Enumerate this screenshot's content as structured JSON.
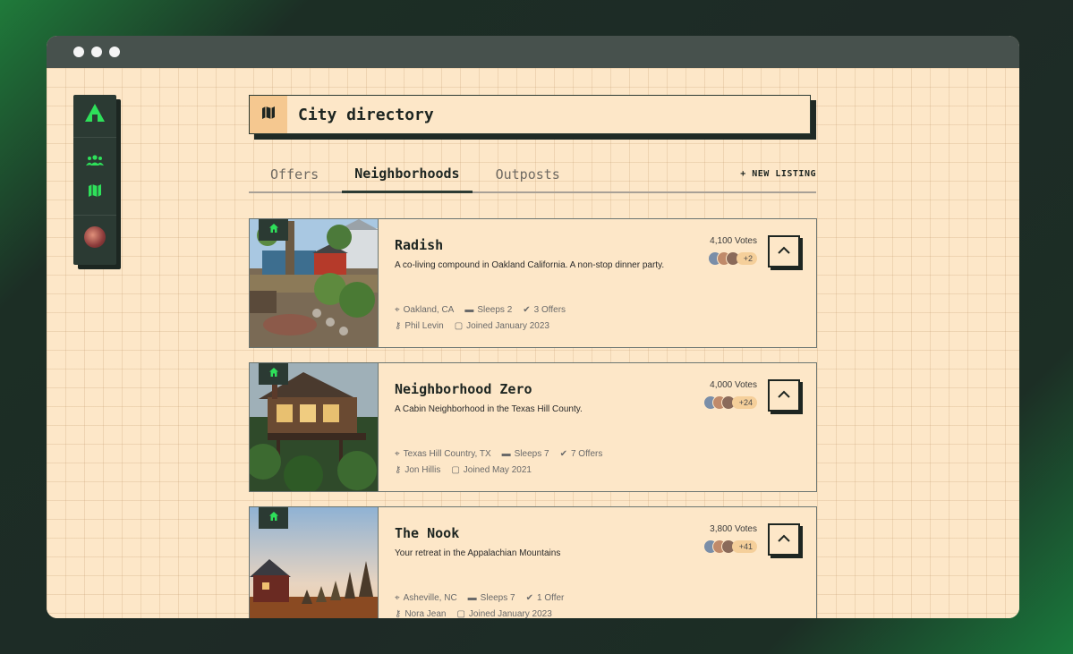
{
  "window": {
    "buttons": [
      "close",
      "minimize",
      "maximize"
    ]
  },
  "sidebar": {
    "logo_icon": "home-triangle-icon",
    "items": [
      {
        "icon": "people-icon"
      },
      {
        "icon": "map-icon"
      }
    ],
    "avatar": "user-avatar"
  },
  "search": {
    "icon": "map-icon",
    "title": "City directory"
  },
  "tabs": {
    "items": [
      {
        "label": "Offers"
      },
      {
        "label": "Neighborhoods"
      },
      {
        "label": "Outposts"
      }
    ],
    "active": "Neighborhoods",
    "new_listing": "+ NEW LISTING"
  },
  "colors": {
    "accent": "#2ee05a",
    "panel": "#2b3a33",
    "background": "#fde7c8",
    "badge": "#f5cf9a"
  },
  "listings": [
    {
      "title": "Radish",
      "description": "A co-living compound in Oakland California. A non-stop dinner party.",
      "location": "Oakland, CA",
      "sleeps": "Sleeps 2",
      "offers": "3 Offers",
      "host": "Phil Levin",
      "joined": "Joined January 2023",
      "votes": "4,100 Votes",
      "more_voters": "+2"
    },
    {
      "title": "Neighborhood Zero",
      "description": "A Cabin Neighborhood in the Texas Hill County.",
      "location": "Texas Hill Country, TX",
      "sleeps": "Sleeps 7",
      "offers": "7 Offers",
      "host": "Jon Hillis",
      "joined": "Joined May 2021",
      "votes": "4,000 Votes",
      "more_voters": "+24"
    },
    {
      "title": "The Nook",
      "description": "Your retreat in the Appalachian Mountains",
      "location": "Asheville, NC",
      "sleeps": "Sleeps 7",
      "offers": "1 Offer",
      "host": "Nora Jean",
      "joined": "Joined January 2023",
      "votes": "3,800 Votes",
      "more_voters": "+41"
    }
  ]
}
